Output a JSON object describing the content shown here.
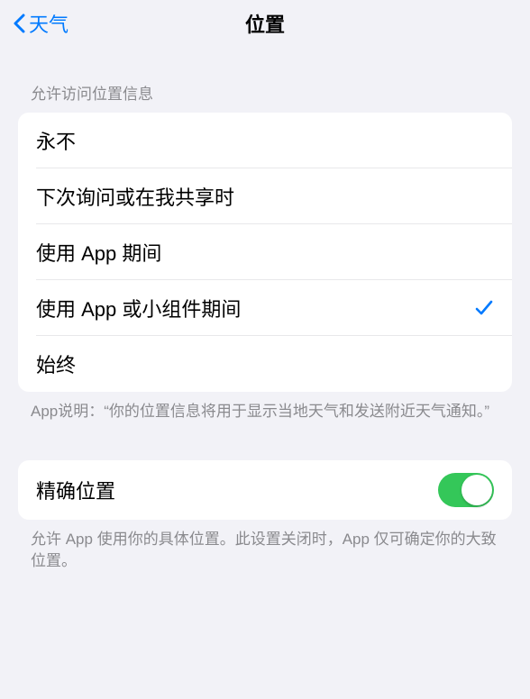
{
  "nav": {
    "back_label": "天气",
    "title": "位置"
  },
  "access_section": {
    "header": "允许访问位置信息",
    "options": [
      {
        "label": "永不",
        "selected": false
      },
      {
        "label": "下次询问或在我共享时",
        "selected": false
      },
      {
        "label": "使用 App 期间",
        "selected": false
      },
      {
        "label": "使用 App 或小组件期间",
        "selected": true
      },
      {
        "label": "始终",
        "selected": false
      }
    ],
    "footer": "App说明：“你的位置信息将用于显示当地天气和发送附近天气通知。”"
  },
  "precise_section": {
    "label": "精确位置",
    "enabled": true,
    "footer": "允许 App 使用你的具体位置。此设置关闭时，App 仅可确定你的大致位置。"
  },
  "colors": {
    "accent": "#007aff",
    "switch_on": "#34c759"
  }
}
